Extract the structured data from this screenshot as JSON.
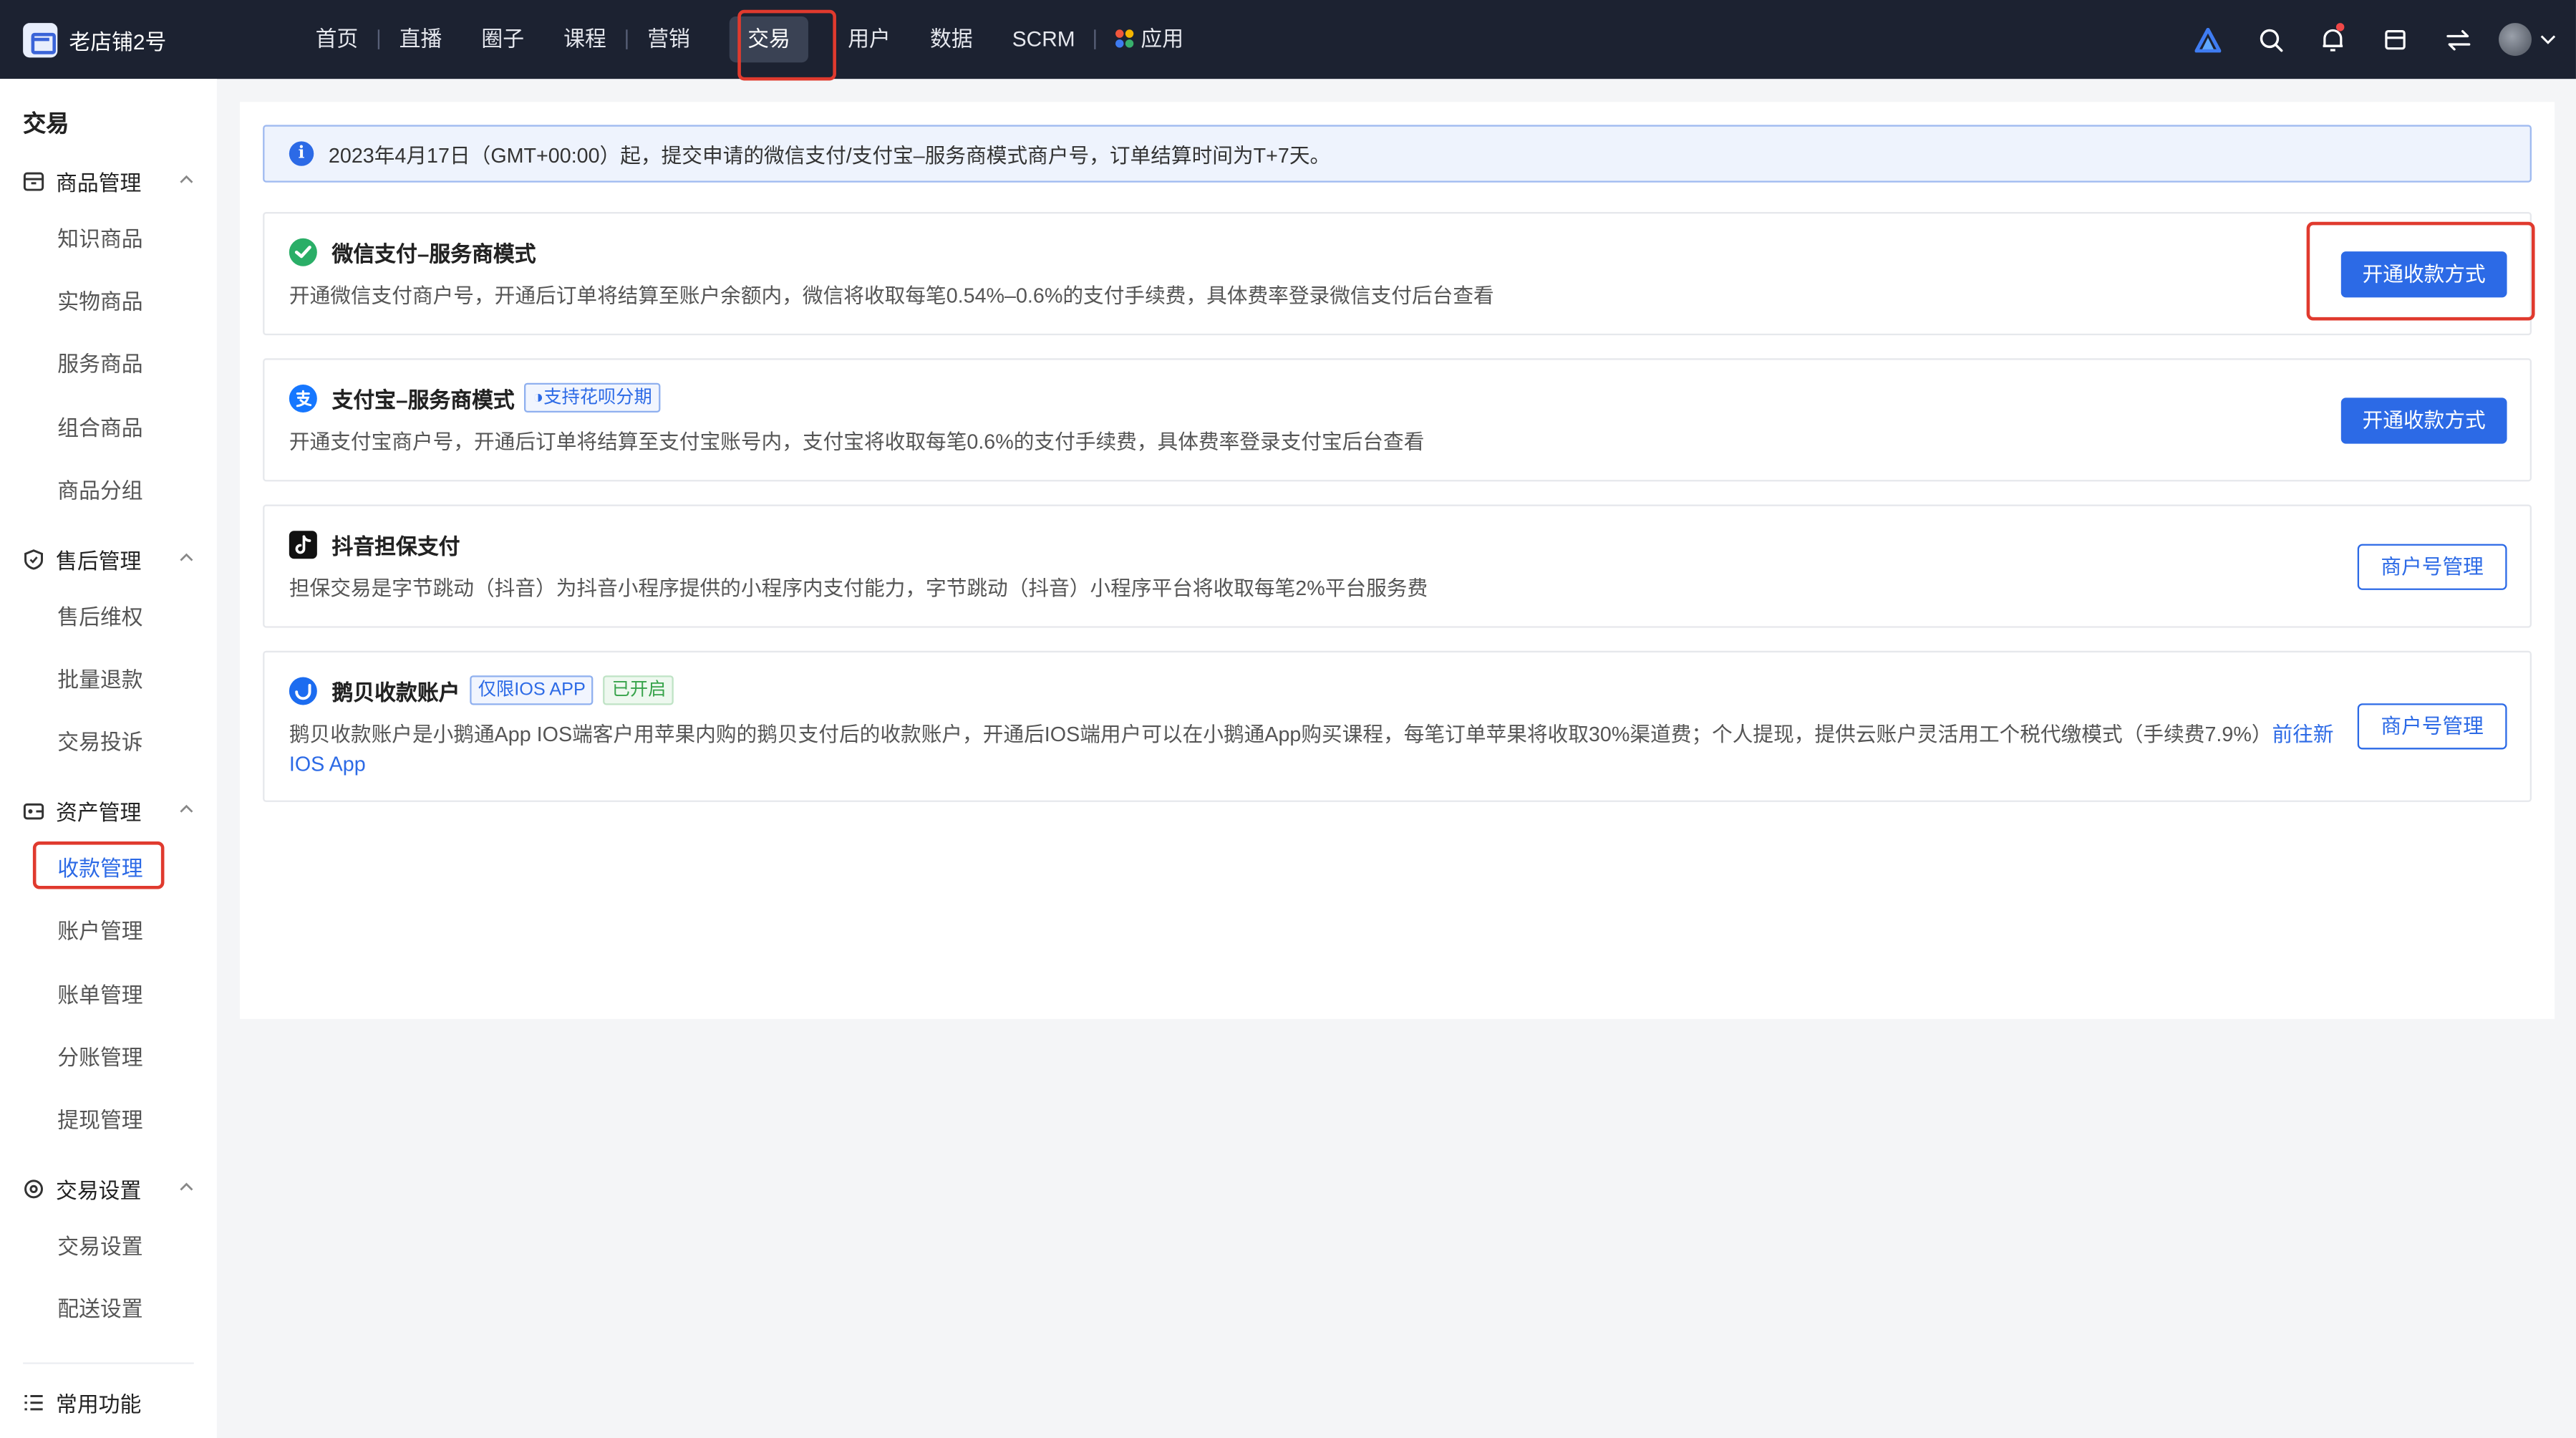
{
  "brand": {
    "name": "老店铺2号"
  },
  "nav": {
    "items": [
      "首页",
      "直播",
      "圈子",
      "课程",
      "营销",
      "交易",
      "用户",
      "数据",
      "SCRM",
      "应用"
    ],
    "active": "交易"
  },
  "top_icons": [
    "logo-triangle-icon",
    "search-icon",
    "bell-icon",
    "shop-icon",
    "switch-icon",
    "avatar"
  ],
  "sidebar": {
    "title": "交易",
    "groups": [
      {
        "label": "商品管理",
        "icon": "box-icon",
        "items": [
          "知识商品",
          "实物商品",
          "服务商品",
          "组合商品",
          "商品分组"
        ]
      },
      {
        "label": "售后管理",
        "icon": "shield-icon",
        "items": [
          "售后维权",
          "批量退款",
          "交易投诉"
        ]
      },
      {
        "label": "资产管理",
        "icon": "wallet-icon",
        "items": [
          "收款管理",
          "账户管理",
          "账单管理",
          "分账管理",
          "提现管理"
        ]
      },
      {
        "label": "交易设置",
        "icon": "settings-icon",
        "items": [
          "交易设置",
          "配送设置"
        ]
      }
    ],
    "active_item": "收款管理",
    "footer": {
      "label": "常用功能",
      "icon": "list-icon"
    }
  },
  "notice": {
    "text": "2023年4月17日（GMT+00:00）起，提交申请的微信支付/支付宝–服务商模式商户号，订单结算时间为T+7天。"
  },
  "payments": [
    {
      "title": "微信支付–服务商模式",
      "icon": "wechat-pay-icon",
      "desc": "开通微信支付商户号，开通后订单将结算至账户余额内，微信将收取每笔0.54%–0.6%的支付手续费，具体费率登录微信支付后台查看",
      "button": "开通收款方式"
    },
    {
      "title": "支付宝–服务商模式",
      "icon": "alipay-icon",
      "tag": "支持花呗分期",
      "desc": "开通支付宝商户号，开通后订单将结算至支付宝账号内，支付宝将收取每笔0.6%的支付手续费，具体费率登录支付宝后台查看",
      "button": "开通收款方式"
    },
    {
      "title": "抖音担保支付",
      "icon": "douyin-icon",
      "desc": "担保交易是字节跳动（抖音）为抖音小程序提供的小程序内支付能力，字节跳动（抖音）小程序平台将收取每笔2%平台服务费",
      "button": "商户号管理"
    },
    {
      "title": "鹅贝收款账户",
      "icon": "ebei-icon",
      "tag": "仅限IOS APP",
      "status": "已开启",
      "desc": "鹅贝收款账户是小鹅通App IOS端客户用苹果内购的鹅贝支付后的收款账户，开通后IOS端用户可以在小鹅通App购买课程，每笔订单苹果将收取30%渠道费；个人提现，提供云账户灵活用工个税代缴模式（手续费7.9%）",
      "link": "前往新IOS App",
      "button": "商户号管理"
    }
  ],
  "colors": {
    "topbar": "#1c2231",
    "primary": "#2c6ae6",
    "highlight_frame": "#e03a2e",
    "status_green": "#37a34a"
  }
}
